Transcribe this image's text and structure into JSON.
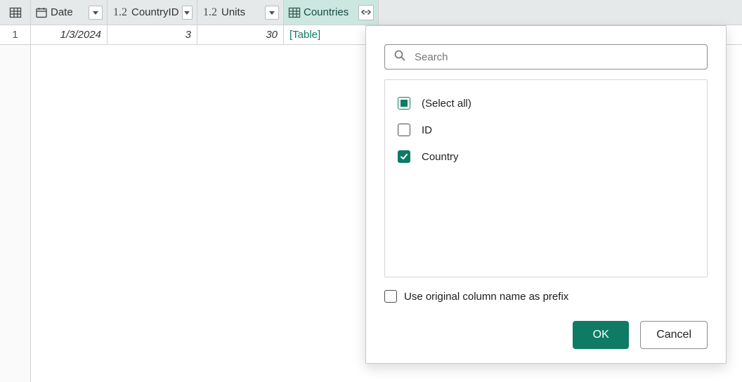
{
  "columns": {
    "date": "Date",
    "country_id": "CountryID",
    "units": "Units",
    "countries": "Countries",
    "num_type": "1.2"
  },
  "row": {
    "index": "1",
    "date": "1/3/2024",
    "country_id": "3",
    "units": "30",
    "countries": "[Table]"
  },
  "panel": {
    "search_placeholder": "Search",
    "select_all": "(Select all)",
    "opt_id": "ID",
    "opt_country": "Country",
    "prefix": "Use original column name as prefix",
    "ok": "OK",
    "cancel": "Cancel"
  }
}
